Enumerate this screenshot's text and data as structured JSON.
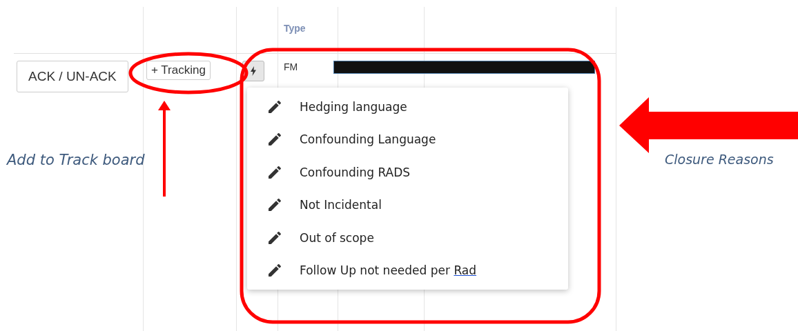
{
  "table": {
    "column_4_header": "Type",
    "row": {
      "ack_button": "ACK / UN-ACK",
      "tracking_button": "+ Tracking",
      "column_4": "FM"
    }
  },
  "closure_menu": {
    "items": [
      {
        "text": "Hedging language"
      },
      {
        "text": "Confounding Language"
      },
      {
        "text": "Confounding RADS"
      },
      {
        "text": "Not Incidental"
      },
      {
        "text": "Out of scope"
      },
      {
        "text": "Follow Up not needed per ",
        "underlined": "Rad"
      }
    ]
  },
  "annotations": {
    "left_label": "Add to Track board",
    "right_label": "Closure Reasons"
  }
}
